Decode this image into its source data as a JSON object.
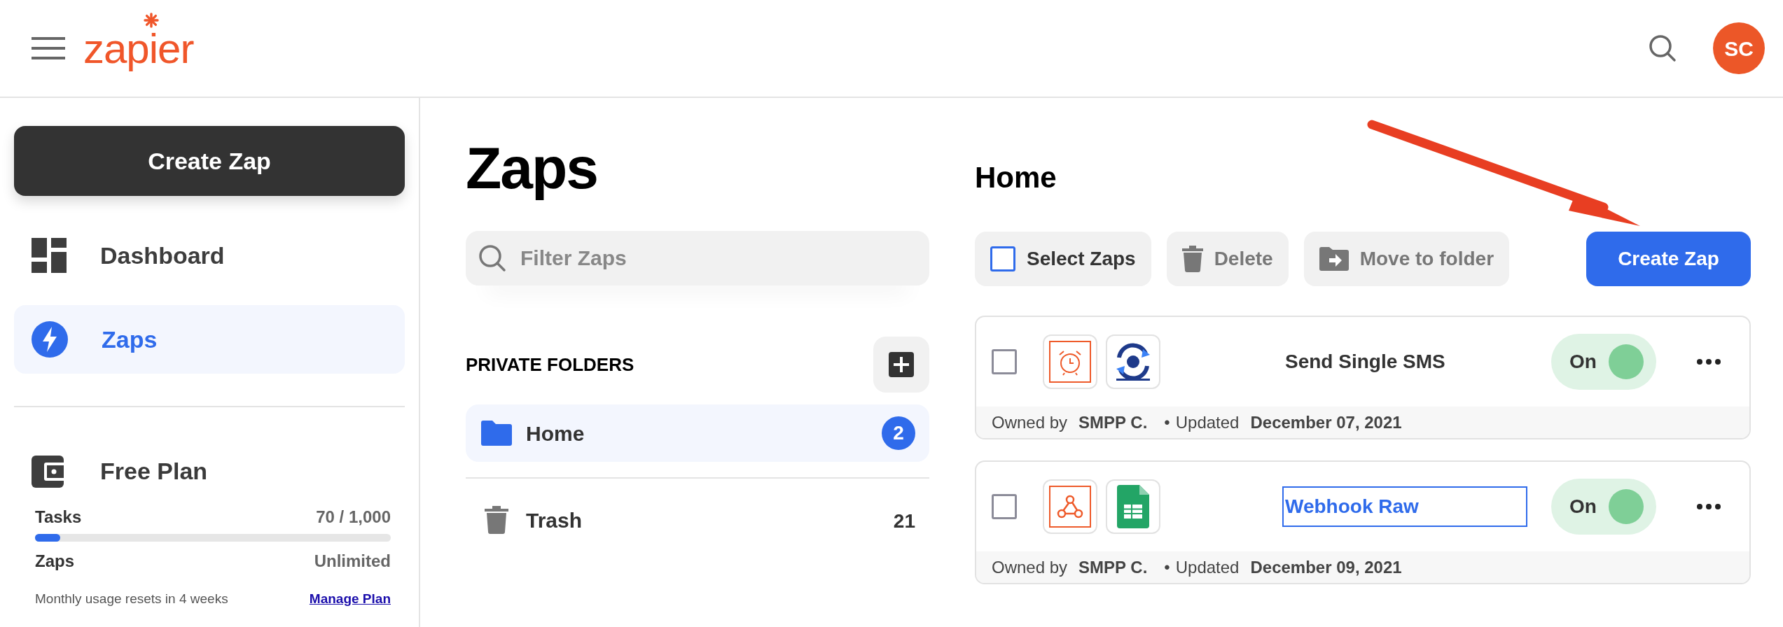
{
  "header": {
    "logo": "zapier",
    "avatar": "SC"
  },
  "sidebar": {
    "create_button": "Create Zap",
    "items": [
      {
        "label": "Dashboard",
        "kind": "dashboard",
        "selected": false
      },
      {
        "label": "Zaps",
        "kind": "zap",
        "selected": true
      }
    ],
    "plan": {
      "title": "Free Plan",
      "usage": [
        {
          "label": "Tasks",
          "value": "70 / 1,000",
          "kind": "meter",
          "level": 0.07
        },
        {
          "label": "Zaps",
          "value": "Unlimited",
          "kind": "plain"
        }
      ],
      "note": "Monthly usage resets in 4 weeks",
      "link": "Manage Plan"
    }
  },
  "folders_panel": {
    "title": "Zaps",
    "filter": {
      "placeholder": "Filter Zaps"
    },
    "section_label": "PRIVATE FOLDERS",
    "folders": [
      {
        "name": "Home",
        "count": "2",
        "kind": "folder",
        "selected": true
      },
      {
        "name": "Trash",
        "count": "21",
        "kind": "trash",
        "selected": false
      }
    ]
  },
  "main": {
    "title": "Home",
    "toolbar": [
      {
        "label": "Select Zaps",
        "kind": "select"
      },
      {
        "label": "Delete",
        "kind": "delete"
      },
      {
        "label": "Move to folder",
        "kind": "move"
      }
    ],
    "create_button": "Create Zap",
    "zaps": [
      {
        "name": "Send Single SMS",
        "apps": [
          {
            "kind": "schedule"
          },
          {
            "kind": "sms-gateway"
          }
        ],
        "checked": false,
        "focused": false,
        "on": true,
        "toggle_label": "On",
        "owner_label": "Owned by",
        "owner": "SMPP C.",
        "separator": "•",
        "updated_label": "Updated",
        "updated": "December 07, 2021"
      },
      {
        "name": "Webhook Raw",
        "apps": [
          {
            "kind": "webhook"
          },
          {
            "kind": "sheets"
          }
        ],
        "checked": false,
        "focused": true,
        "on": true,
        "toggle_label": "On",
        "owner_label": "Owned by",
        "owner": "SMPP C.",
        "separator": "•",
        "updated_label": "Updated",
        "updated": "December 09, 2021"
      }
    ]
  },
  "annotation": {
    "kind": "arrow"
  }
}
